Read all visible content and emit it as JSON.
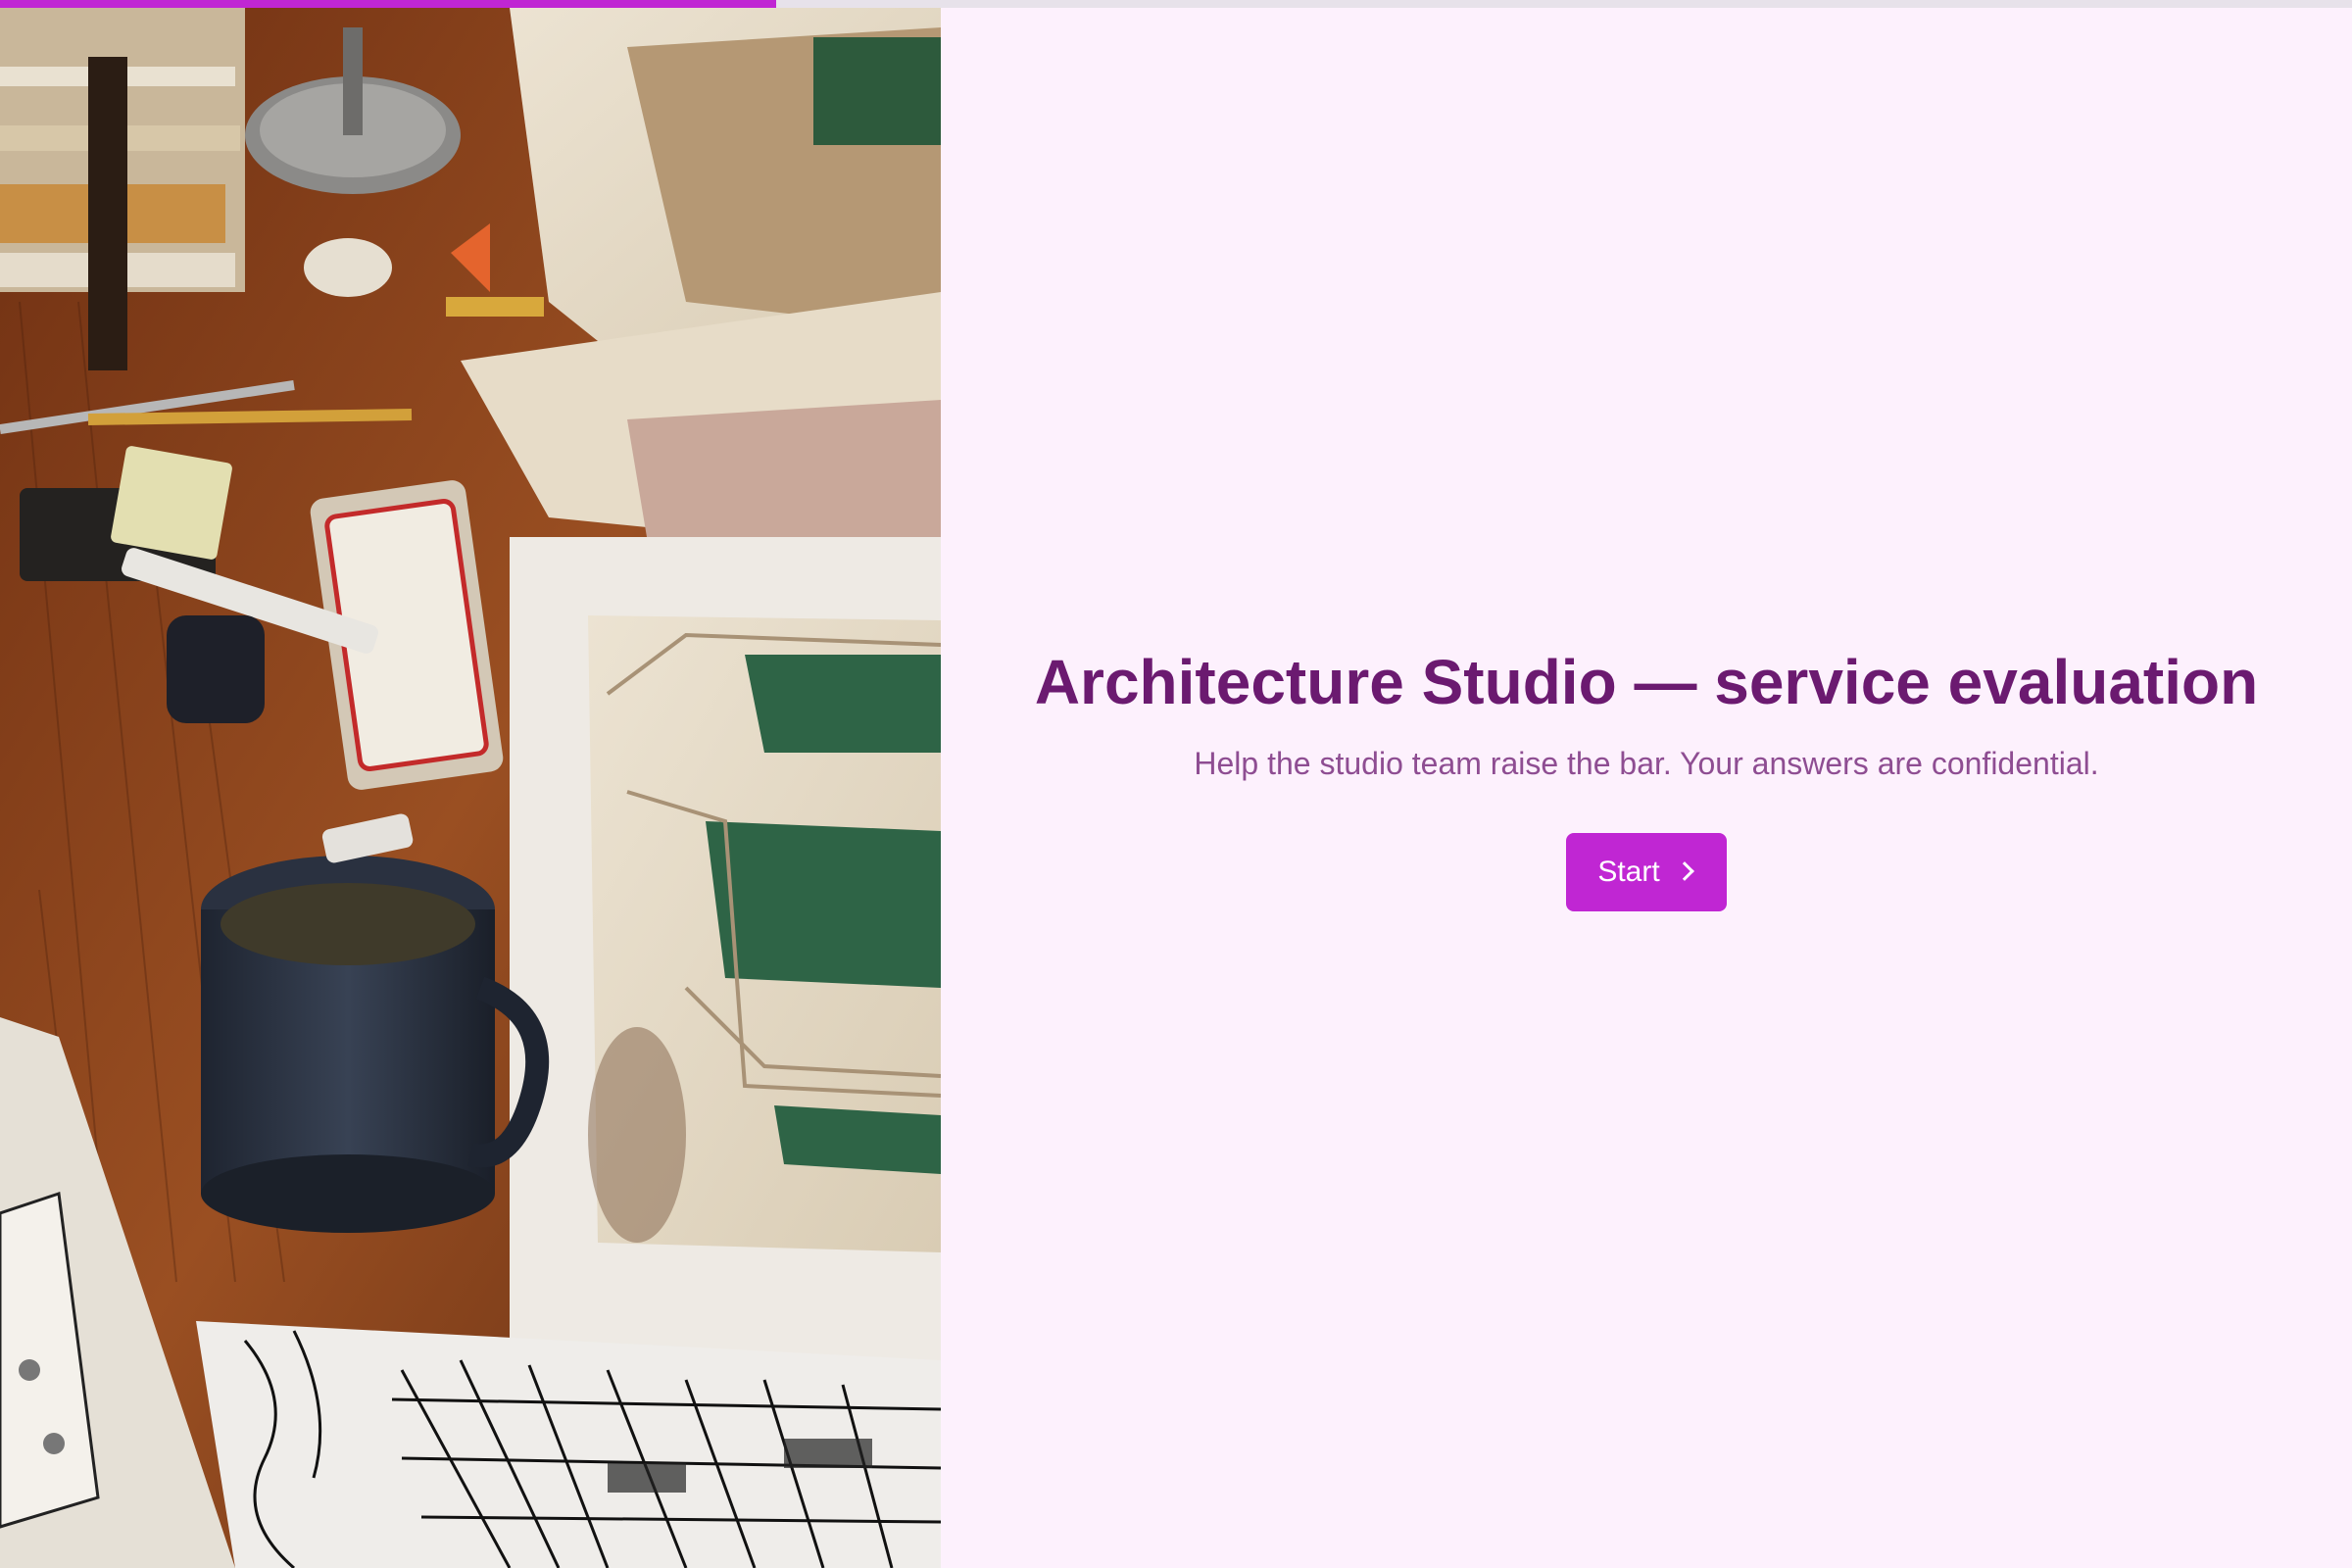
{
  "progress": {
    "fraction": 0.33,
    "fill_color": "#c026d3",
    "track_color": "#e7e2ea"
  },
  "hero_image": {
    "icon": "architecture-desk-photo"
  },
  "welcome": {
    "title": "Architecture Studio — service evaluation",
    "subtitle": "Help the studio team raise the bar. Your answers are confidential.",
    "start_label": "Start",
    "start_icon": "chevron-right-icon"
  },
  "colors": {
    "background": "#fdf1fd",
    "title": "#6b1a70",
    "subtitle": "#8e4d92",
    "accent": "#c026d3"
  }
}
